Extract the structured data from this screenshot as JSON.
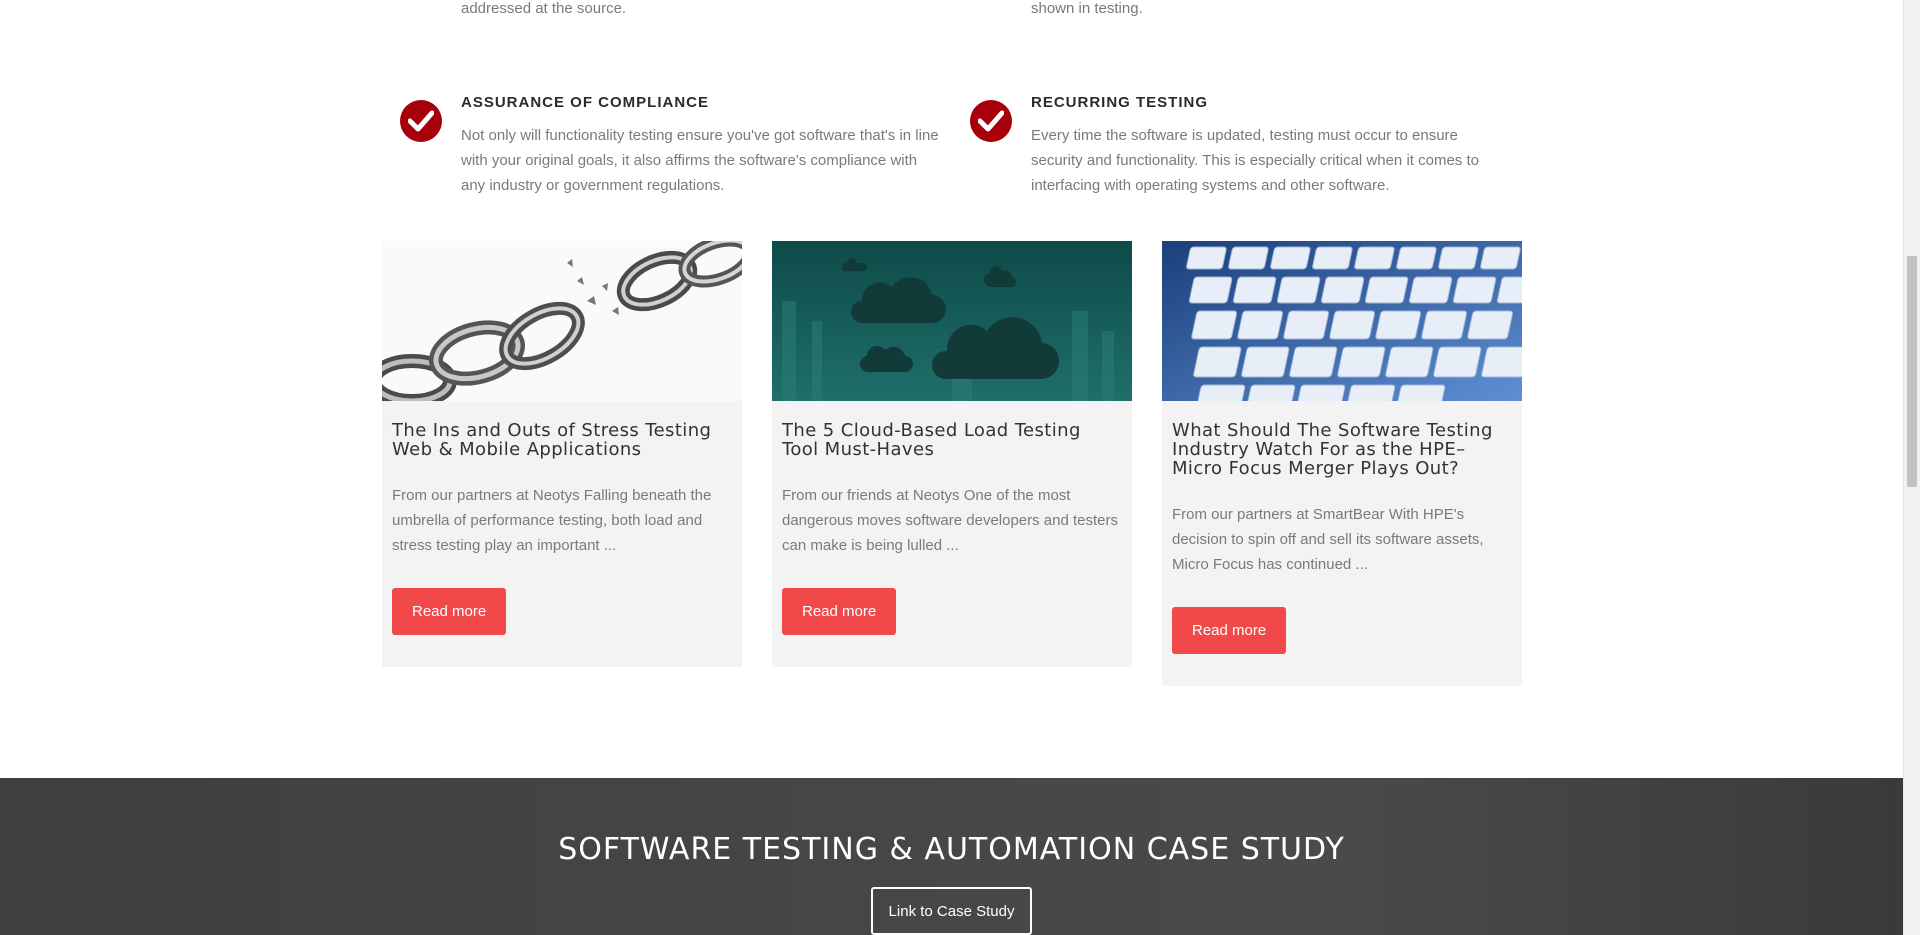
{
  "top_fragments": {
    "left": "addressed at the source.",
    "right": "shown in testing."
  },
  "features": [
    {
      "title": "ASSURANCE OF COMPLIANCE",
      "text": "Not only will functionality testing ensure you've got software that's in line with your original goals, it also affirms the software's compliance with any industry or government regulations.",
      "icon": "check-circle-icon"
    },
    {
      "title": "RECURRING TESTING",
      "text": "Every time the software is updated, testing must occur to ensure security and functionality. This is especially critical when it comes to interfacing with operating systems and other software.",
      "icon": "check-circle-icon"
    }
  ],
  "posts": [
    {
      "image": "broken-chain-image",
      "title": "The Ins and Outs of Stress Testing Web & Mobile Applications",
      "excerpt": "From our partners at Neotys Falling beneath the umbrella of performance testing, both load and stress testing play an important ...",
      "button": "Read more"
    },
    {
      "image": "clouds-image",
      "title": "The 5 Cloud-Based Load Testing Tool Must-Haves",
      "excerpt": "From our friends at Neotys One of the most dangerous moves software developers and testers can make is being lulled ...",
      "button": "Read more"
    },
    {
      "image": "keyboard-image",
      "title": "What Should The Software Testing Industry Watch For as the HPE–Micro Focus Merger Plays Out?",
      "excerpt": "From our partners at SmartBear With HPE's decision to spin off and sell its software assets, Micro Focus has continued ...",
      "button": "Read more"
    }
  ],
  "case_study": {
    "title": "SOFTWARE TESTING & AUTOMATION CASE STUDY",
    "button": "Link to Case Study"
  },
  "colors": {
    "accent_red": "#f1494a",
    "check_red": "#a8000a",
    "band_gray": "#464646"
  }
}
